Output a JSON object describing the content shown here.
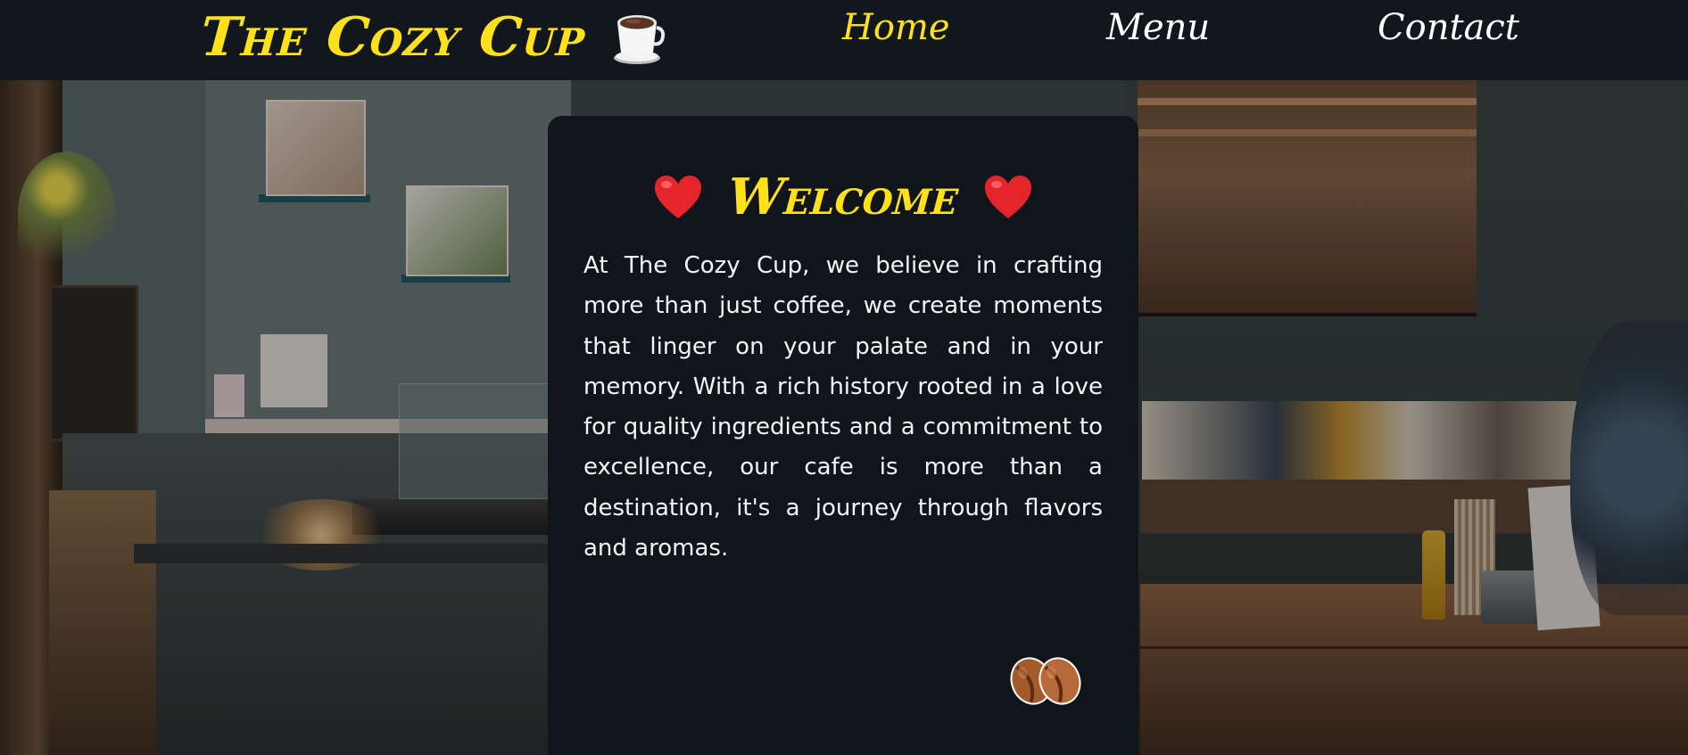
{
  "header": {
    "brand": "The Cozy Cup",
    "logo_icon": "coffee-cup-icon",
    "nav": [
      {
        "label": "Home",
        "active": true
      },
      {
        "label": "Menu",
        "active": false
      },
      {
        "label": "Contact",
        "active": false
      }
    ]
  },
  "hero": {
    "background_image": "cafe-interior-photo"
  },
  "welcome": {
    "title": "Welcome",
    "title_icon": "red-heart-icon",
    "body": "At The Cozy Cup, we believe in crafting more than just coffee, we create moments that linger on your palate and in your memory. With a rich history rooted in a love for quality ingredients and a commitment to excellence, our cafe is more than a destination, it's a journey through flavors and aromas.",
    "decoration_icon": "coffee-beans-icon"
  },
  "colors": {
    "accent": "#ffe11a",
    "nav_bg": "#11171d",
    "card_bg": "#0f151b",
    "text": "#f4f4f4",
    "heart": "#e5242b"
  }
}
